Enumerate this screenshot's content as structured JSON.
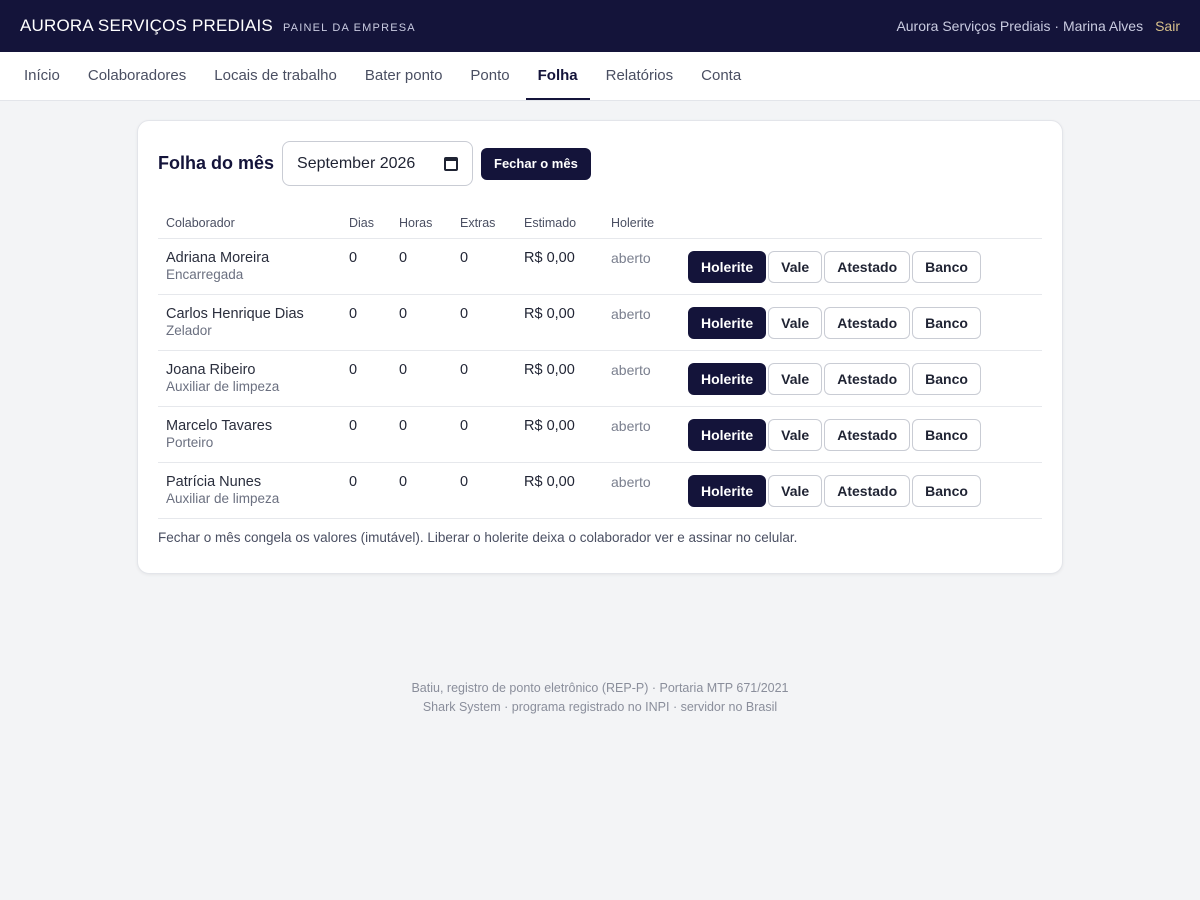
{
  "header": {
    "brand": "AURORA SERVIÇOS PREDIAIS",
    "subtitle": "PAINEL DA EMPRESA",
    "user": "Aurora Serviços Prediais · Marina Alves",
    "logout": "Sair"
  },
  "nav": {
    "tabs": [
      {
        "label": "Início"
      },
      {
        "label": "Colaboradores"
      },
      {
        "label": "Locais de trabalho"
      },
      {
        "label": "Bater ponto"
      },
      {
        "label": "Ponto"
      },
      {
        "label": "Folha"
      },
      {
        "label": "Relatórios"
      },
      {
        "label": "Conta"
      }
    ],
    "active": "Folha"
  },
  "payroll": {
    "title": "Folha do mês",
    "month_value": "September 2026",
    "close_button": "Fechar o mês",
    "columns": [
      "Colaborador",
      "Dias",
      "Horas",
      "Extras",
      "Estimado",
      "Holerite"
    ],
    "actions": [
      "Holerite",
      "Vale",
      "Atestado",
      "Banco"
    ],
    "rows": [
      {
        "name": "Adriana Moreira",
        "role": "Encarregada",
        "dias": "0",
        "horas": "0",
        "extras": "0",
        "estimado": "R$ 0,00",
        "holerite": "aberto"
      },
      {
        "name": "Carlos Henrique Dias",
        "role": "Zelador",
        "dias": "0",
        "horas": "0",
        "extras": "0",
        "estimado": "R$ 0,00",
        "holerite": "aberto"
      },
      {
        "name": "Joana Ribeiro",
        "role": "Auxiliar de limpeza",
        "dias": "0",
        "horas": "0",
        "extras": "0",
        "estimado": "R$ 0,00",
        "holerite": "aberto"
      },
      {
        "name": "Marcelo Tavares",
        "role": "Porteiro",
        "dias": "0",
        "horas": "0",
        "extras": "0",
        "estimado": "R$ 0,00",
        "holerite": "aberto"
      },
      {
        "name": "Patrícia Nunes",
        "role": "Auxiliar de limpeza",
        "dias": "0",
        "horas": "0",
        "extras": "0",
        "estimado": "R$ 0,00",
        "holerite": "aberto"
      }
    ],
    "note": "Fechar o mês congela os valores (imutável). Liberar o holerite deixa o colaborador ver e assinar no celular."
  },
  "footer": {
    "line1": "Batiu, registro de ponto eletrônico (REP-P) · Portaria MTP 671/2021",
    "line2": "Shark System · programa registrado no INPI · servidor no Brasil"
  },
  "colors": {
    "navy": "#14143a",
    "accent": "#d7c08a"
  }
}
